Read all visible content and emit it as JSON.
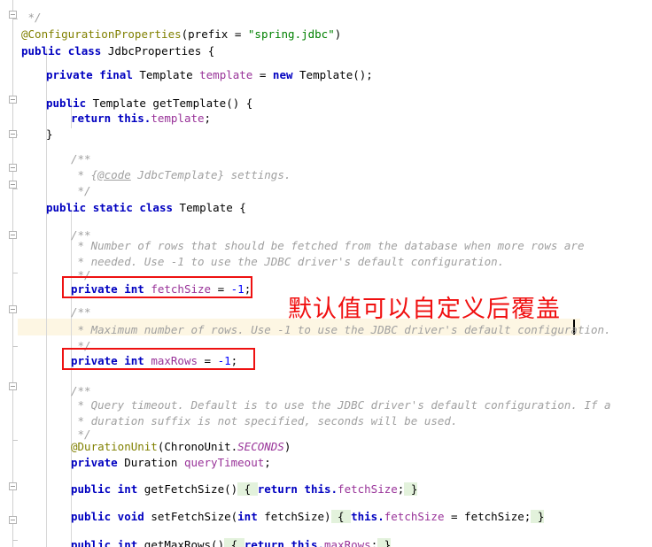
{
  "editor": {
    "language": "java",
    "theme": "light",
    "colors": {
      "background": "#ffffff",
      "keyword": "#0000c0",
      "string": "#008000",
      "number": "#0000ff",
      "field": "#993399",
      "annotation": "#808000",
      "comment": "#a0a0a0",
      "caret_row_highlight": "#fdf6e3",
      "brace_match_highlight": "#e3f2dc",
      "annotation_red": "#ee1111",
      "fold_line": "#d0d0d0",
      "indent_guide": "#d8d8d8"
    },
    "caret": {
      "visible": true,
      "at_line_index": 17
    }
  },
  "code_lines": [
    {
      "indent": 1,
      "text": " */"
    },
    {
      "indent": 0,
      "text": "@ConfigurationProperties(prefix = \"spring.jdbc\")"
    },
    {
      "indent": 0,
      "text": "public class JdbcProperties {"
    },
    {
      "indent": 0,
      "text": ""
    },
    {
      "indent": 1,
      "text": "private final Template template = new Template();"
    },
    {
      "indent": 0,
      "text": ""
    },
    {
      "indent": 1,
      "text": "public Template getTemplate() {"
    },
    {
      "indent": 2,
      "text": "return this.template;"
    },
    {
      "indent": 1,
      "text": "}"
    },
    {
      "indent": 0,
      "text": ""
    },
    {
      "indent": 1,
      "text": "/**"
    },
    {
      "indent": 1,
      "text": " * {@code JdbcTemplate} settings."
    },
    {
      "indent": 1,
      "text": " */"
    },
    {
      "indent": 1,
      "text": "public static class Template {"
    },
    {
      "indent": 0,
      "text": ""
    },
    {
      "indent": 2,
      "text": "/**"
    },
    {
      "indent": 2,
      "text": " * Number of rows that should be fetched from the database when more rows are"
    },
    {
      "indent": 2,
      "text": " * needed. Use -1 to use the JDBC driver's default configuration."
    },
    {
      "indent": 2,
      "text": " */"
    },
    {
      "indent": 2,
      "text": "private int fetchSize = -1;"
    },
    {
      "indent": 0,
      "text": ""
    },
    {
      "indent": 2,
      "text": "/**"
    },
    {
      "indent": 2,
      "text": " * Maximum number of rows. Use -1 to use the JDBC driver's default configuration."
    },
    {
      "indent": 2,
      "text": " */"
    },
    {
      "indent": 2,
      "text": "private int maxRows = -1;"
    },
    {
      "indent": 0,
      "text": ""
    },
    {
      "indent": 2,
      "text": "/**"
    },
    {
      "indent": 2,
      "text": " * Query timeout. Default is to use the JDBC driver's default configuration. If a"
    },
    {
      "indent": 2,
      "text": " * duration suffix is not specified, seconds will be used."
    },
    {
      "indent": 2,
      "text": " */"
    },
    {
      "indent": 2,
      "text": "@DurationUnit(ChronoUnit.SECONDS)"
    },
    {
      "indent": 2,
      "text": "private Duration queryTimeout;"
    },
    {
      "indent": 0,
      "text": ""
    },
    {
      "indent": 2,
      "text": "public int getFetchSize() { return this.fetchSize; }"
    },
    {
      "indent": 0,
      "text": ""
    },
    {
      "indent": 2,
      "text": "public void setFetchSize(int fetchSize) { this.fetchSize = fetchSize; }"
    },
    {
      "indent": 0,
      "text": ""
    },
    {
      "indent": 2,
      "text": "public int getMaxRows() { return this.maxRows; }"
    }
  ],
  "tokens": {
    "l0_comment_close": " */",
    "l1_annotation": "@ConfigurationProperties",
    "l1_paren_open": "(prefix = ",
    "l1_string": "\"spring.jdbc\"",
    "l1_paren_close": ")",
    "l2_public": "public",
    "l2_class": "class",
    "l2_name": "JdbcProperties {",
    "l4_private": "private",
    "l4_final": "final",
    "l4_type": "Template ",
    "l4_field": "template",
    "l4_eq": " = ",
    "l4_new": "new",
    "l4_ctor": " Template();",
    "l6_public": "public",
    "l6_sig": " Template getTemplate() {",
    "l7_return": "return",
    "l7_this": " this.",
    "l7_field": "template",
    "l7_semi": ";",
    "l8_brace": "}",
    "l10_doc_open": "/**",
    "l11_doc_star": " * {",
    "l11_doc_code": "@code",
    "l11_doc_rest": " JdbcTemplate} settings.",
    "l12_doc_close": " */",
    "l13_public": "public",
    "l13_static": "static",
    "l13_class": "class",
    "l13_name": "Template {",
    "l15_doc_open": "/**",
    "l16_doc": " * Number of rows that should be fetched from the database when more rows are",
    "l17_doc": " * needed. Use -1 to use the JDBC driver's default configuration.",
    "l18_doc_close": " */",
    "l19_private": "private",
    "l19_int": "int",
    "l19_field": " fetchSize",
    "l19_eq": " = ",
    "l19_num": "-1",
    "l19_semi": ";",
    "l21_doc_open": "/**",
    "l22_doc": " * Maximum number of rows. Use -1 to use the JDBC driver's default configuration.",
    "l23_doc_close": " */",
    "l24_private": "private",
    "l24_int": "int",
    "l24_field": " maxRows",
    "l24_eq": " = ",
    "l24_num": "-1",
    "l24_semi": ";",
    "l26_doc_open": "/**",
    "l27_doc": " * Query timeout. Default is to use the JDBC driver's default configuration. If a",
    "l28_doc": " * duration suffix is not specified, seconds will be used.",
    "l29_doc_close": " */",
    "l30_annotation": "@DurationUnit",
    "l30_paren": "(ChronoUnit.",
    "l30_const": "SECONDS",
    "l30_paren_close": ")",
    "l31_private": "private",
    "l31_type": " Duration ",
    "l31_field": "queryTimeout",
    "l31_semi": ";",
    "l33_public": "public",
    "l33_int": " int",
    "l33_sig": " getFetchSize()",
    "l33_brace_open": " { ",
    "l33_return": "return",
    "l33_this": " this.",
    "l33_field": "fetchSize",
    "l33_semi": ";",
    "l33_brace_close": " }",
    "l35_public": "public",
    "l35_void": " void",
    "l35_sig": " setFetchSize(",
    "l35_int": "int",
    "l35_param": " fetchSize)",
    "l35_brace_open": " { ",
    "l35_this": "this.",
    "l35_field": "fetchSize",
    "l35_assign": " = fetchSize;",
    "l35_brace_close": " }",
    "l37_public": "public",
    "l37_int": " int",
    "l37_sig": " getMaxRows()",
    "l37_brace_open": " { ",
    "l37_return": "return",
    "l37_this": " this.",
    "l37_field": "maxRows",
    "l37_semi": ";",
    "l37_brace_close": " }"
  },
  "annotations": {
    "note_text": "默认值可以自定义后覆盖",
    "note_color": "#f01010",
    "boxes": [
      {
        "target": "private int fetchSize = -1;"
      },
      {
        "target": "private int maxRows = -1;"
      }
    ]
  }
}
